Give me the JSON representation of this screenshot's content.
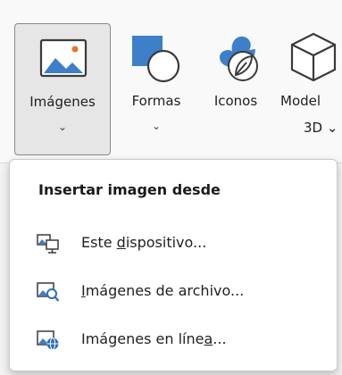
{
  "ribbon": {
    "images_button": {
      "label": "Imágenes",
      "chevron": "⌄"
    },
    "shapes_button": {
      "label": "Formas",
      "chevron": "⌄"
    },
    "icons_button": {
      "label": "Iconos"
    },
    "models_button": {
      "label": "Model",
      "label_line2": "3D ⌄"
    }
  },
  "menu": {
    "title": "Insertar imagen desde",
    "items": [
      {
        "pre": "Este ",
        "accel": "d",
        "post": "ispositivo...",
        "icon": "device-image-icon"
      },
      {
        "pre": "",
        "accel": "I",
        "post": "mágenes de archivo...",
        "icon": "stock-image-search-icon"
      },
      {
        "pre": "Imágenes en líne",
        "accel": "a",
        "post": "...",
        "icon": "online-image-icon"
      }
    ]
  },
  "colors": {
    "accent_blue": "#2b6ebf",
    "accent_orange": "#e8742a"
  }
}
